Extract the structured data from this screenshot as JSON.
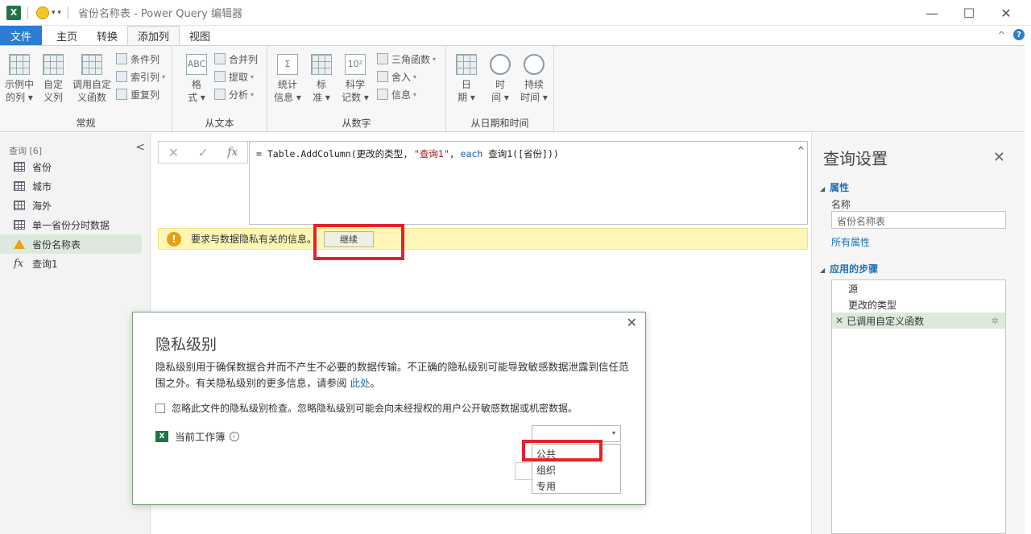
{
  "titlebar": {
    "app_badge": "X",
    "title": "省份名称表 - Power Query 编辑器",
    "minimize": "—",
    "maximize": "☐",
    "close": "✕"
  },
  "menu": {
    "file": "文件",
    "tabs": [
      "主页",
      "转换",
      "添加列",
      "视图"
    ],
    "active_tab": "添加列",
    "collapse": "^",
    "help": "?"
  },
  "ribbon": {
    "general": {
      "label": "常规",
      "example_col": [
        "示例中",
        "的列 ▾"
      ],
      "custom_col": [
        "自定",
        "义列"
      ],
      "invoke_func": [
        "调用自定",
        "义函数"
      ],
      "conditional": "条件列",
      "index": "索引列",
      "duplicate": "重复列"
    },
    "text": {
      "label": "从文本",
      "format": [
        "格",
        "式 ▾"
      ],
      "merge": "合并列",
      "extract": "提取",
      "parse": "分析"
    },
    "number": {
      "label": "从数字",
      "statistics": [
        "统计",
        "信息 ▾"
      ],
      "standard": [
        "标",
        "准 ▾"
      ],
      "scientific": [
        "科学",
        "记数 ▾"
      ],
      "trig": "三角函数",
      "rounding": "舍入",
      "info": "信息"
    },
    "datetime": {
      "label": "从日期和时间",
      "date": [
        "日",
        "期 ▾"
      ],
      "time": [
        "时",
        "间 ▾"
      ],
      "duration": [
        "持续",
        "时间 ▾"
      ]
    }
  },
  "queries": {
    "header": "查询 [6]",
    "collapse": "<",
    "items": [
      {
        "label": "省份",
        "type": "table"
      },
      {
        "label": "城市",
        "type": "table"
      },
      {
        "label": "海外",
        "type": "table"
      },
      {
        "label": "单一省份分时数据",
        "type": "table"
      },
      {
        "label": "省份名称表",
        "type": "warning"
      },
      {
        "label": "查询1",
        "type": "function"
      }
    ],
    "selected": "省份名称表"
  },
  "formula": {
    "cancel": "✕",
    "confirm": "✓",
    "fx": "fx",
    "text_prefix": "= Table.AddColumn(更改的类型, ",
    "text_string": "\"查询1\"",
    "text_comma": ", ",
    "text_keyword": "each",
    "text_suffix": " 查询1([省份]))",
    "expand": "^"
  },
  "infobar": {
    "icon": "!",
    "message": "要求与数据隐私有关的信息。",
    "button": "继续"
  },
  "settings": {
    "title": "查询设置",
    "close": "✕",
    "properties_header": "属性",
    "name_label": "名称",
    "name_value": "省份名称表",
    "all_properties": "所有属性",
    "steps_header": "应用的步骤",
    "steps": [
      "源",
      "更改的类型",
      "已调用自定义函数"
    ],
    "selected_step": "已调用自定义函数"
  },
  "dialog": {
    "close": "✕",
    "title": "隐私级别",
    "description": "隐私级别用于确保数据合并而不产生不必要的数据传输。不正确的隐私级别可能导致敏感数据泄露到信任范围之外。有关隐私级别的更多信息，请参阅 ",
    "link": "此处",
    "period": "。",
    "ignore_checkbox": "忽略此文件的隐私级别检查。忽略隐私级别可能会向未经授权的用户公开敏感数据或机密数据。",
    "source_label": "当前工作簿",
    "source_info": "i",
    "select_value": "",
    "options": [
      "公共",
      "组织",
      "专用"
    ]
  },
  "colors": {
    "accent": "#2b7cd3",
    "excel_green": "#217346",
    "warning_bg": "#fdf6b5",
    "highlight_red": "#e5212b",
    "selected_row": "#dde9dd"
  }
}
